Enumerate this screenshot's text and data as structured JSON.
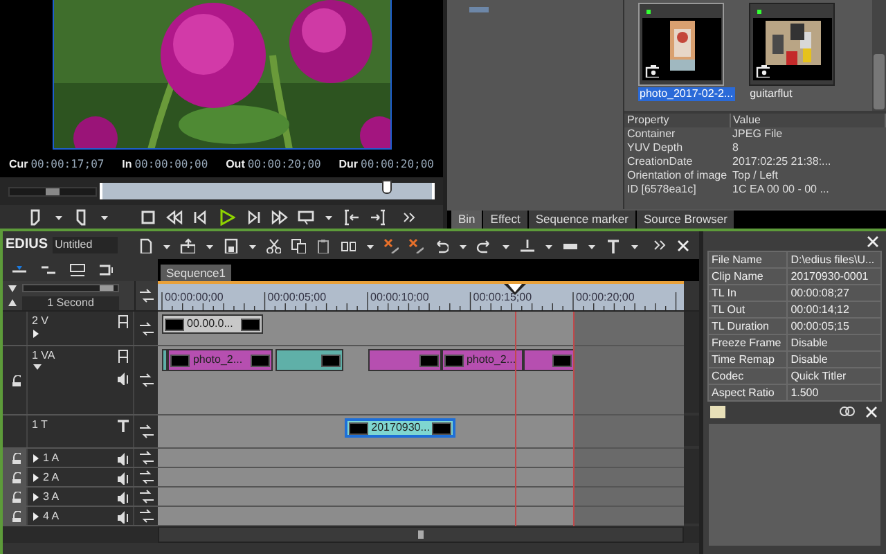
{
  "player": {
    "timecodes": [
      {
        "label": "Cur",
        "value": "00:00:17;07"
      },
      {
        "label": "In",
        "value": "00:00:00;00"
      },
      {
        "label": "Out",
        "value": "00:00:20;00"
      },
      {
        "label": "Dur",
        "value": "00:00:20;00"
      }
    ],
    "scrub": {
      "level": 0.86
    },
    "shuttle": {
      "level": 0.5
    }
  },
  "bin": {
    "clips": [
      {
        "name": "photo_2017-02-2...",
        "selected": true
      },
      {
        "name": "guitarflut",
        "selected": false
      }
    ],
    "properties": {
      "columns": [
        "Property",
        "Value"
      ],
      "rows": [
        [
          "Container",
          "JPEG File"
        ],
        [
          "YUV Depth",
          "8"
        ],
        [
          "CreationDate",
          "2017:02:25 21:38:..."
        ],
        [
          "Orientation of image",
          "Top / Left"
        ],
        [
          "ID [6578ea1c]",
          "1C EA 00 00 - 00 ..."
        ]
      ]
    },
    "tabs": [
      {
        "label": "Bin",
        "selected": true
      },
      {
        "label": "Effect",
        "selected": false
      },
      {
        "label": "Sequence marker",
        "selected": false
      },
      {
        "label": "Source Browser",
        "selected": false
      }
    ]
  },
  "timeline": {
    "app": "EDIUS",
    "project": "Untitled",
    "sequence": "Sequence1",
    "zoom": "1 Second",
    "zoom_slider": {
      "level": 0.88
    },
    "ruler": [
      "00:00:00;00",
      "00:00:05;00",
      "00:00:10;00",
      "00:00:15;00",
      "00:00:20;00"
    ],
    "tracks": [
      {
        "name": "2 V",
        "kind": "video",
        "clips": [
          {
            "label": "00.00.0...",
            "color": "#c8c8c8",
            "selected": false
          }
        ]
      },
      {
        "name": "1 VA",
        "kind": "videoaudio",
        "clips": [
          {
            "color": "#5fb0a8",
            "selected": false
          },
          {
            "label": "photo_2...",
            "color": "#b64fb0",
            "selected": false
          },
          {
            "color": "#5fb0a8",
            "selected": false
          },
          {
            "color": "#b64fb0",
            "selected": false
          },
          {
            "label": "photo_2...",
            "color": "#b64fb0",
            "selected": false
          },
          {
            "color": "#b64fb0",
            "selected": false
          }
        ]
      },
      {
        "name": "1 T",
        "kind": "title",
        "clips": [
          {
            "label": "20170930...",
            "color": "#7fd6d0",
            "selected": true
          }
        ]
      },
      {
        "name": "1 A",
        "kind": "audio"
      },
      {
        "name": "2 A",
        "kind": "audio"
      },
      {
        "name": "3 A",
        "kind": "audio"
      },
      {
        "name": "4 A",
        "kind": "audio"
      }
    ]
  },
  "info": {
    "rows": [
      [
        "File Name",
        "D:\\edius files\\U..."
      ],
      [
        "Clip Name",
        "20170930-0001"
      ],
      [
        "TL In",
        "00:00:08;27"
      ],
      [
        "TL Out",
        "00:00:14;12"
      ],
      [
        "TL Duration",
        "00:00:05;15"
      ],
      [
        "Freeze Frame",
        "Disable"
      ],
      [
        "Time Remap",
        "Disable"
      ],
      [
        "Codec",
        "Quick Titler"
      ],
      [
        "Aspect Ratio",
        "1.500"
      ]
    ]
  }
}
